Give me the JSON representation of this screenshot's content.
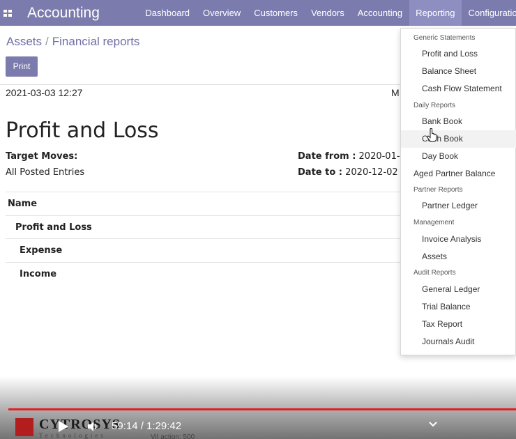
{
  "navbar": {
    "brand": "Accounting",
    "items": [
      "Dashboard",
      "Overview",
      "Customers",
      "Vendors",
      "Accounting",
      "Reporting",
      "Configuration"
    ],
    "active": "Reporting",
    "color": "#7c7bad"
  },
  "breadcrumb": {
    "parent": "Assets",
    "separator": "/",
    "current": "Financial reports"
  },
  "toolbar": {
    "print_label": "Print"
  },
  "report": {
    "datetime": "2021-03-03 12:27",
    "partial_right_label": "M",
    "title": "Profit and Loss",
    "target_moves_label": "Target Moves:",
    "target_moves_value": "All Posted Entries",
    "date_from_label": "Date from :",
    "date_from_value": "2020-01-",
    "date_to_label": "Date to :",
    "date_to_value": "2020-12-02",
    "table_header": "Name",
    "rows": [
      "Profit and Loss",
      "Expense",
      "Income"
    ]
  },
  "reporting_menu": {
    "generic_header": "Generic Statements",
    "profit_loss": "Profit and Loss",
    "balance_sheet": "Balance Sheet",
    "cash_flow": "Cash Flow Statement",
    "daily_header": "Daily Reports",
    "bank_book": "Bank Book",
    "cash_book": "Cash Book",
    "day_book": "Day Book",
    "aged_partner": "Aged Partner Balance",
    "partner_header": "Partner Reports",
    "partner_ledger": "Partner Ledger",
    "management_header": "Management",
    "invoice_analysis": "Invoice Analysis",
    "assets": "Assets",
    "audit_header": "Audit Reports",
    "general_ledger": "General Ledger",
    "trial_balance": "Trial Balance",
    "tax_report": "Tax Report",
    "journals_audit": "Journals Audit"
  },
  "video": {
    "logo_text": "CYTROSYS",
    "logo_subtext": "Technologies",
    "time_display": "59:14 / 1:29:42",
    "caption_fragment": "ViI action: 500",
    "progress_fraction": 0.66,
    "progress_color": "#e41f1f"
  },
  "icons": [
    "apps-icon",
    "play-icon",
    "volume-icon",
    "chevron-down-icon",
    "hand-cursor-icon"
  ]
}
